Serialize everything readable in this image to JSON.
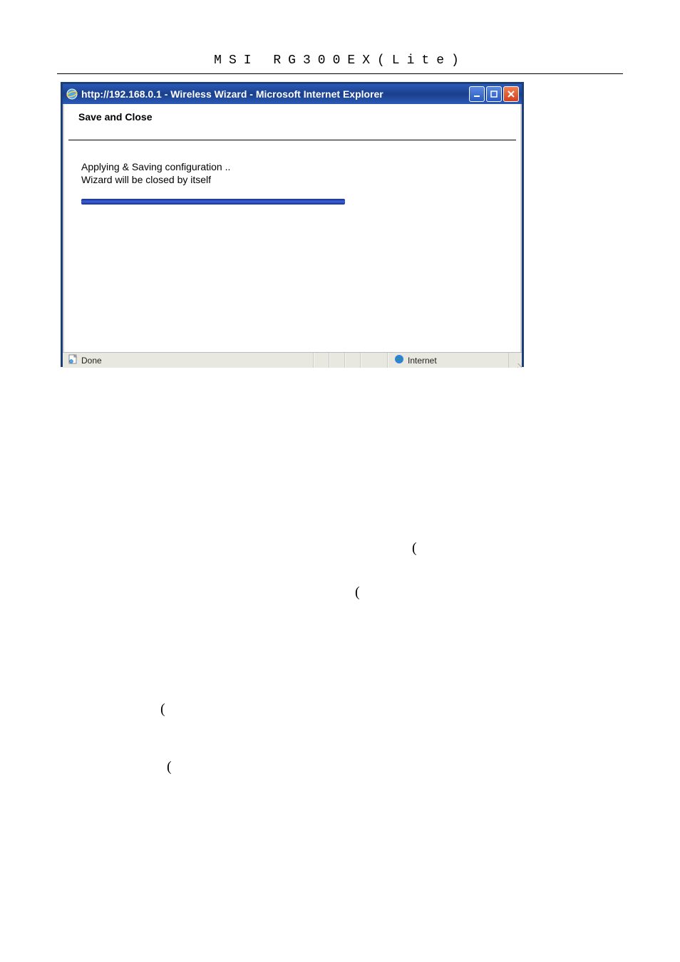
{
  "header": {
    "title": "MSI RG300EX(Lite)"
  },
  "window": {
    "title": "http://192.168.0.1 - Wireless Wizard - Microsoft Internet Explorer",
    "content": {
      "heading": "Save and Close",
      "line1": "Applying & Saving configuration ..",
      "line2": "Wizard will be closed by itself"
    },
    "statusbar": {
      "status_text": "Done",
      "zone_text": "Internet"
    }
  },
  "parens": {
    "p1": "(",
    "p2": "(",
    "p3": "(",
    "p4": "("
  }
}
